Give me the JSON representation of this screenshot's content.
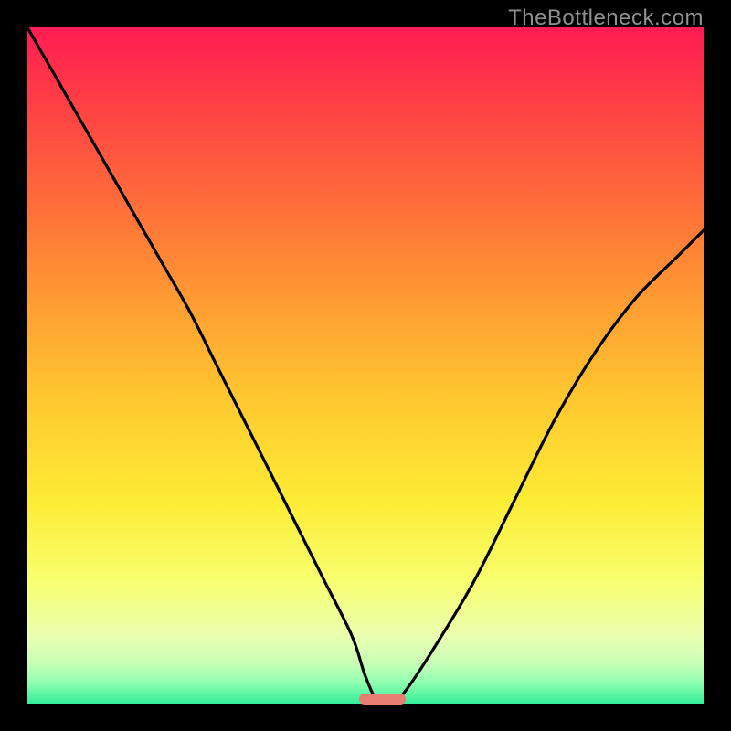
{
  "attribution": "TheBottleneck.com",
  "chart_data": {
    "type": "line",
    "title": "",
    "xlabel": "",
    "ylabel": "",
    "xlim": [
      0,
      100
    ],
    "ylim": [
      0,
      100
    ],
    "grid": false,
    "legend": false,
    "background": {
      "gradient": "vertical",
      "stops": [
        {
          "pos": 0.0,
          "color": "#ff1c52"
        },
        {
          "pos": 0.1,
          "color": "#ff3b46"
        },
        {
          "pos": 0.25,
          "color": "#ff6a3a"
        },
        {
          "pos": 0.4,
          "color": "#ff9a33"
        },
        {
          "pos": 0.55,
          "color": "#ffc82f"
        },
        {
          "pos": 0.7,
          "color": "#fdec34"
        },
        {
          "pos": 0.82,
          "color": "#f8ff70"
        },
        {
          "pos": 0.9,
          "color": "#eaffb0"
        },
        {
          "pos": 0.94,
          "color": "#c9ffb0"
        },
        {
          "pos": 0.97,
          "color": "#8dffb0"
        },
        {
          "pos": 1.0,
          "color": "#33ee99"
        }
      ]
    },
    "series": [
      {
        "name": "bottleneck-curve",
        "color": "#000000",
        "x": [
          0,
          4,
          8,
          12,
          16,
          20,
          24,
          28,
          32,
          36,
          40,
          44,
          48,
          50,
          52,
          54,
          56,
          60,
          66,
          72,
          78,
          84,
          90,
          96,
          100
        ],
        "y": [
          100,
          93,
          86,
          79,
          72,
          65,
          58,
          50,
          42,
          34,
          26,
          18,
          10,
          4,
          0,
          0,
          2,
          8,
          18,
          30,
          42,
          52,
          60,
          66,
          70
        ]
      }
    ],
    "annotations": [
      {
        "name": "optimal-marker",
        "type": "capsule",
        "color": "#e97e72",
        "x_start": 49,
        "x_end": 56,
        "y": 0
      }
    ]
  }
}
